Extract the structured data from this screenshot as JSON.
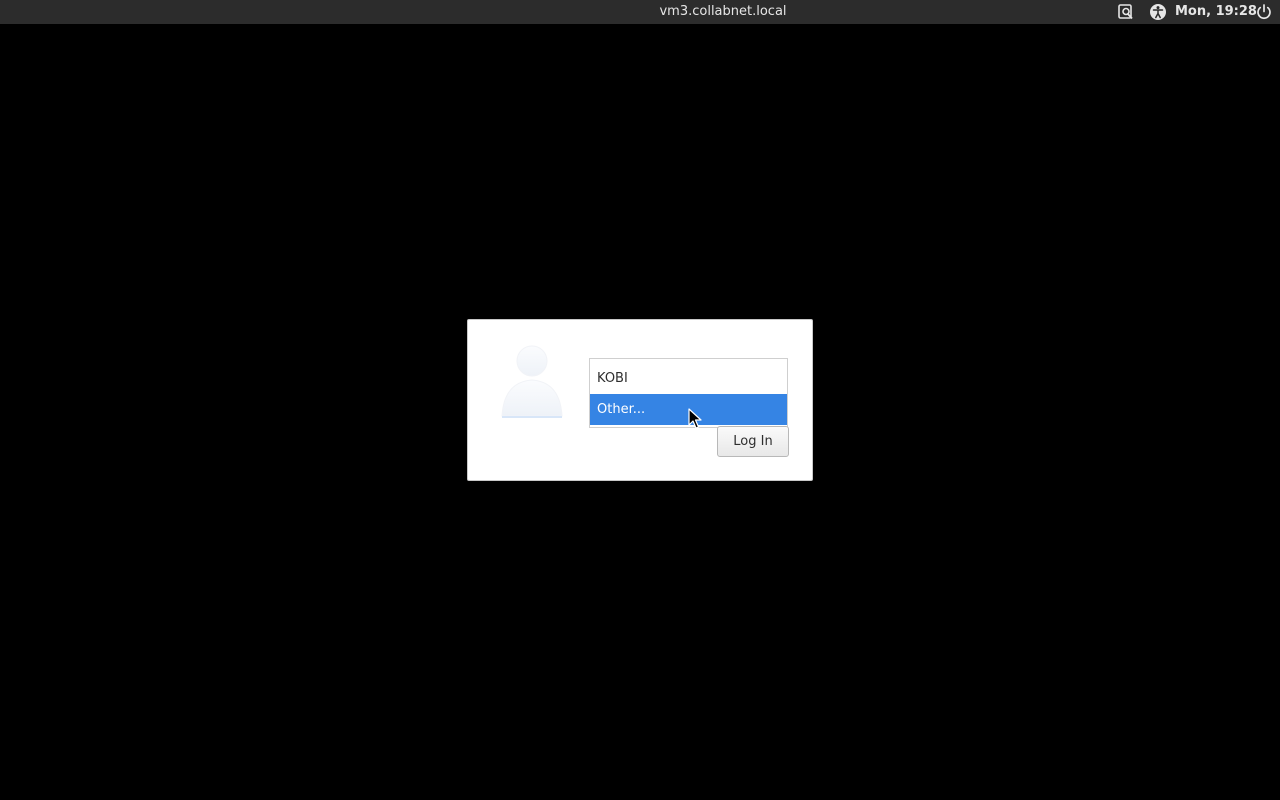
{
  "topbar": {
    "hostname": "vm3.collabnet.local",
    "clock": "Mon, 19:28",
    "icons": {
      "keyboard": "keyboard-layout-icon",
      "accessibility": "accessibility-icon",
      "power": "power-icon"
    }
  },
  "login": {
    "users": [
      {
        "label": "KOBI",
        "selected": false
      },
      {
        "label": "Other...",
        "selected": true
      }
    ],
    "login_button_label": "Log In",
    "avatar_icon": "user-avatar-icon"
  },
  "colors": {
    "selection": "#3584e4",
    "topbar": "#2c2c2c",
    "background": "#000000"
  }
}
